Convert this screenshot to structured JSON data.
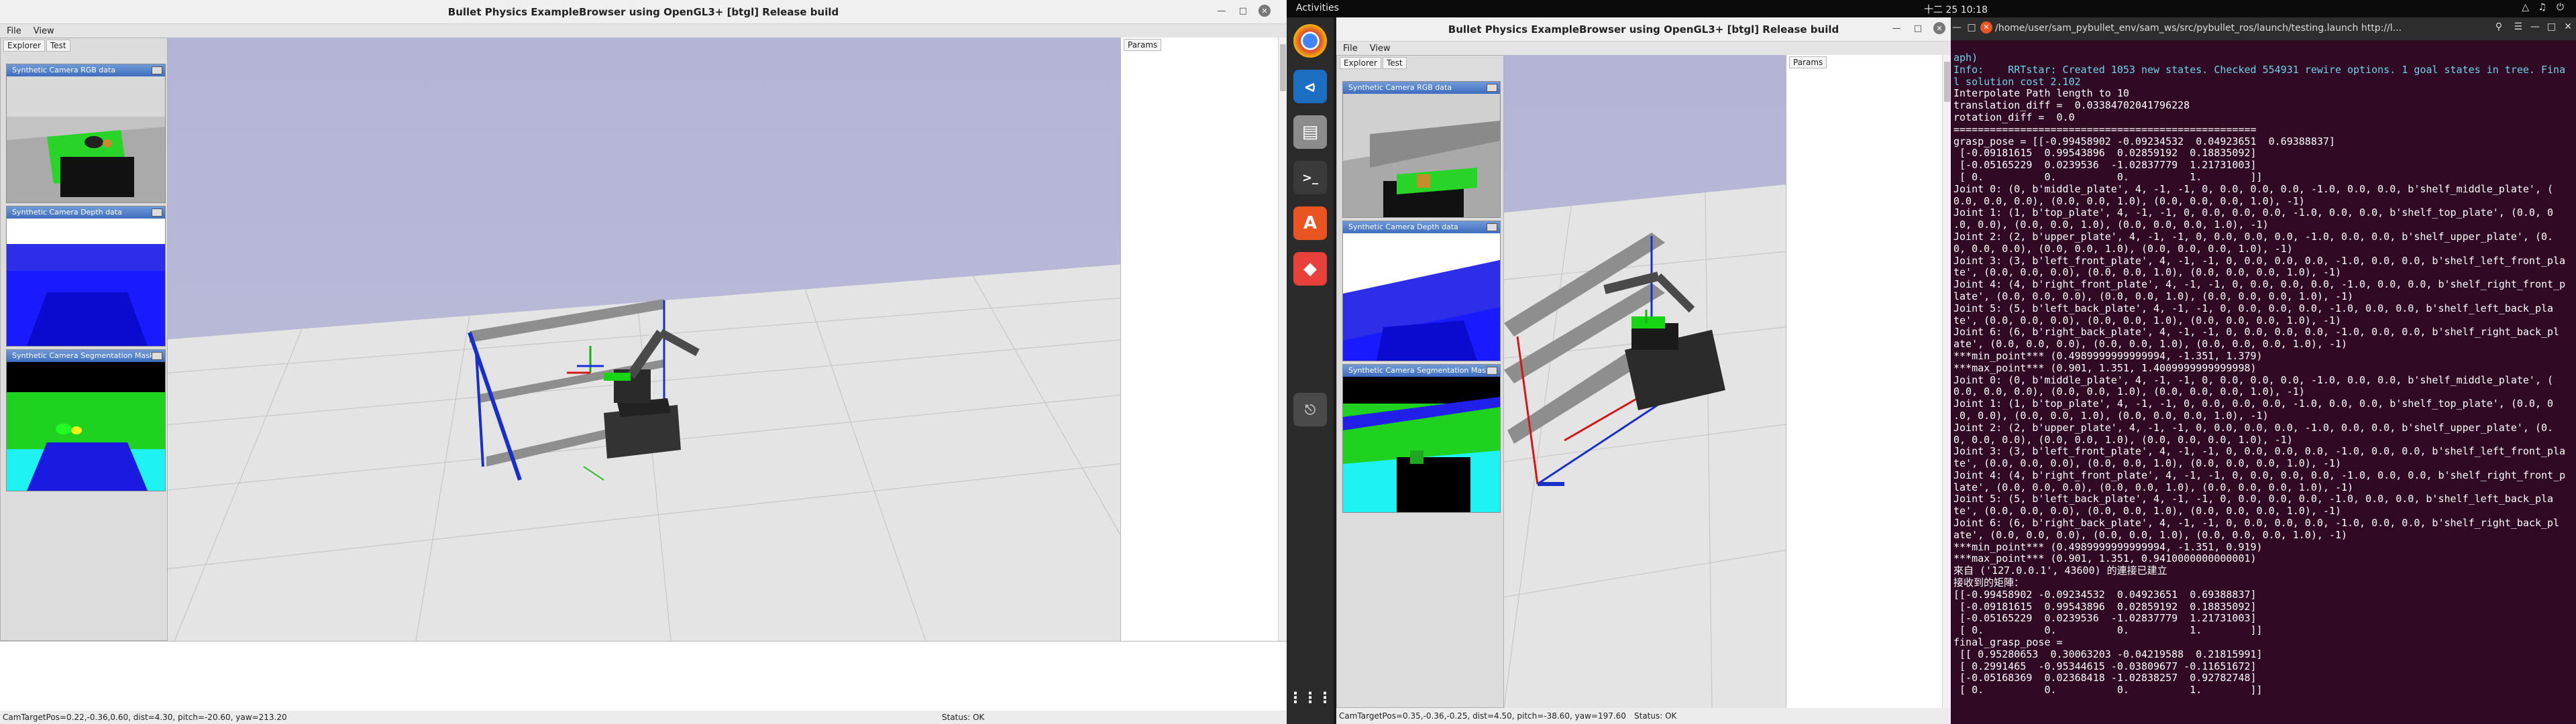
{
  "left_window": {
    "title": "Bullet Physics ExampleBrowser using OpenGL3+ [btgl] Release build",
    "menu": [
      "File",
      "View"
    ],
    "sidebar_tabs": [
      "Explorer",
      "Test"
    ],
    "cam_panels": [
      {
        "title": "Synthetic Camera RGB data"
      },
      {
        "title": "Synthetic Camera Depth data"
      },
      {
        "title": "Synthetic Camera Segmentation Mask"
      }
    ],
    "params_tab": "Params",
    "status_left": "CamTargetPos=0.22,-0.36,0.60, dist=4.30, pitch=-20.60, yaw=213.20",
    "status_right": "Status: OK"
  },
  "right_window": {
    "title": "Bullet Physics ExampleBrowser using OpenGL3+ [btgl] Release build",
    "menu": [
      "File",
      "View"
    ],
    "sidebar_tabs": [
      "Explorer",
      "Test"
    ],
    "cam_panels": [
      {
        "title": "Synthetic Camera RGB data"
      },
      {
        "title": "Synthetic Camera Depth data"
      },
      {
        "title": "Synthetic Camera Segmentation Mask"
      }
    ],
    "params_tab": "Params",
    "status_left": "CamTargetPos=0.35,-0.36,-0.25, dist=4.50, pitch=-38.60, yaw=197.60",
    "status_right": "Status: OK"
  },
  "topbar": {
    "activities": "Activities",
    "clock": "十二 25  10:18"
  },
  "dock": {
    "icons": [
      "chrome-icon",
      "vscode-icon",
      "files-icon",
      "terminal-icon",
      "software-icon",
      "git-icon",
      "usb-icon",
      "apps-grid-icon"
    ]
  },
  "terminal": {
    "title": "/home/user/sam_pybullet_env/sam_ws/src/pybullet_ros/launch/testing.launch http://l...",
    "lines": [
      {
        "t": "aph)",
        "c": "info"
      },
      {
        "t": "Info:    RRTstar: Created 1053 new states. Checked 554931 rewire options. 1 goal states in tree. Fina",
        "c": "info"
      },
      {
        "t": "l solution cost 2.102",
        "c": "info"
      },
      {
        "t": "Interpolate Path length to 10",
        "c": ""
      },
      {
        "t": "translation_diff =  0.03384702041796228",
        "c": ""
      },
      {
        "t": "rotation_diff =  0.0",
        "c": ""
      },
      {
        "t": "==================================================",
        "c": ""
      },
      {
        "t": "grasp_pose = [[-0.99458902 -0.09234532  0.04923651  0.69388837]",
        "c": ""
      },
      {
        "t": " [-0.09181615  0.99543896  0.02859192  0.18835092]",
        "c": ""
      },
      {
        "t": " [-0.05165229  0.0239536  -1.02837779  1.21731003]",
        "c": ""
      },
      {
        "t": " [ 0.          0.          0.          1.        ]]",
        "c": ""
      },
      {
        "t": "Joint 0: (0, b'middle_plate', 4, -1, -1, 0, 0.0, 0.0, 0.0, -1.0, 0.0, 0.0, b'shelf_middle_plate', (",
        "c": ""
      },
      {
        "t": "0.0, 0.0, 0.0), (0.0, 0.0, 1.0), (0.0, 0.0, 0.0, 1.0), -1)",
        "c": ""
      },
      {
        "t": "Joint 1: (1, b'top_plate', 4, -1, -1, 0, 0.0, 0.0, 0.0, -1.0, 0.0, 0.0, b'shelf_top_plate', (0.0, 0",
        "c": ""
      },
      {
        "t": ".0, 0.0), (0.0, 0.0, 1.0), (0.0, 0.0, 0.0, 1.0), -1)",
        "c": ""
      },
      {
        "t": "Joint 2: (2, b'upper_plate', 4, -1, -1, 0, 0.0, 0.0, 0.0, -1.0, 0.0, 0.0, b'shelf_upper_plate', (0.",
        "c": ""
      },
      {
        "t": "0, 0.0, 0.0), (0.0, 0.0, 1.0), (0.0, 0.0, 0.0, 1.0), -1)",
        "c": ""
      },
      {
        "t": "Joint 3: (3, b'left_front_plate', 4, -1, -1, 0, 0.0, 0.0, 0.0, -1.0, 0.0, 0.0, b'shelf_left_front_pla",
        "c": ""
      },
      {
        "t": "te', (0.0, 0.0, 0.0), (0.0, 0.0, 1.0), (0.0, 0.0, 0.0, 1.0), -1)",
        "c": ""
      },
      {
        "t": "Joint 4: (4, b'right_front_plate', 4, -1, -1, 0, 0.0, 0.0, 0.0, -1.0, 0.0, 0.0, b'shelf_right_front_p",
        "c": ""
      },
      {
        "t": "late', (0.0, 0.0, 0.0), (0.0, 0.0, 1.0), (0.0, 0.0, 0.0, 1.0), -1)",
        "c": ""
      },
      {
        "t": "Joint 5: (5, b'left_back_plate', 4, -1, -1, 0, 0.0, 0.0, 0.0, -1.0, 0.0, 0.0, b'shelf_left_back_pla",
        "c": ""
      },
      {
        "t": "te', (0.0, 0.0, 0.0), (0.0, 0.0, 1.0), (0.0, 0.0, 0.0, 1.0), -1)",
        "c": ""
      },
      {
        "t": "Joint 6: (6, b'right_back_plate', 4, -1, -1, 0, 0.0, 0.0, 0.0, -1.0, 0.0, 0.0, b'shelf_right_back_pl",
        "c": ""
      },
      {
        "t": "ate', (0.0, 0.0, 0.0), (0.0, 0.0, 1.0), (0.0, 0.0, 0.0, 1.0), -1)",
        "c": ""
      },
      {
        "t": "***min_point*** (0.4989999999999994, -1.351, 1.379)",
        "c": ""
      },
      {
        "t": "***max_point*** (0.901, 1.351, 1.4009999999999998)",
        "c": ""
      },
      {
        "t": "Joint 0: (0, b'middle_plate', 4, -1, -1, 0, 0.0, 0.0, 0.0, -1.0, 0.0, 0.0, b'shelf_middle_plate', (",
        "c": ""
      },
      {
        "t": "0.0, 0.0, 0.0), (0.0, 0.0, 1.0), (0.0, 0.0, 0.0, 1.0), -1)",
        "c": ""
      },
      {
        "t": "Joint 1: (1, b'top_plate', 4, -1, -1, 0, 0.0, 0.0, 0.0, -1.0, 0.0, 0.0, b'shelf_top_plate', (0.0, 0",
        "c": ""
      },
      {
        "t": ".0, 0.0), (0.0, 0.0, 1.0), (0.0, 0.0, 0.0, 1.0), -1)",
        "c": ""
      },
      {
        "t": "Joint 2: (2, b'upper_plate', 4, -1, -1, 0, 0.0, 0.0, 0.0, -1.0, 0.0, 0.0, b'shelf_upper_plate', (0.",
        "c": ""
      },
      {
        "t": "0, 0.0, 0.0), (0.0, 0.0, 1.0), (0.0, 0.0, 0.0, 1.0), -1)",
        "c": ""
      },
      {
        "t": "Joint 3: (3, b'left_front_plate', 4, -1, -1, 0, 0.0, 0.0, 0.0, -1.0, 0.0, 0.0, b'shelf_left_front_pla",
        "c": ""
      },
      {
        "t": "te', (0.0, 0.0, 0.0), (0.0, 0.0, 1.0), (0.0, 0.0, 0.0, 1.0), -1)",
        "c": ""
      },
      {
        "t": "Joint 4: (4, b'right_front_plate', 4, -1, -1, 0, 0.0, 0.0, 0.0, -1.0, 0.0, 0.0, b'shelf_right_front_p",
        "c": ""
      },
      {
        "t": "late', (0.0, 0.0, 0.0), (0.0, 0.0, 1.0), (0.0, 0.0, 0.0, 1.0), -1)",
        "c": ""
      },
      {
        "t": "Joint 5: (5, b'left_back_plate', 4, -1, -1, 0, 0.0, 0.0, 0.0, -1.0, 0.0, 0.0, b'shelf_left_back_pla",
        "c": ""
      },
      {
        "t": "te', (0.0, 0.0, 0.0), (0.0, 0.0, 1.0), (0.0, 0.0, 0.0, 1.0), -1)",
        "c": ""
      },
      {
        "t": "Joint 6: (6, b'right_back_plate', 4, -1, -1, 0, 0.0, 0.0, 0.0, -1.0, 0.0, 0.0, b'shelf_right_back_pl",
        "c": ""
      },
      {
        "t": "ate', (0.0, 0.0, 0.0), (0.0, 0.0, 1.0), (0.0, 0.0, 0.0, 1.0), -1)",
        "c": ""
      },
      {
        "t": "***min_point*** (0.4989999999999994, -1.351, 0.919)",
        "c": ""
      },
      {
        "t": "***max_point*** (0.901, 1.351, 0.9410000000000001)",
        "c": ""
      },
      {
        "t": "來自 ('127.0.0.1', 43600) 的連接已建立",
        "c": ""
      },
      {
        "t": "接收到的矩陣：",
        "c": ""
      },
      {
        "t": "[[-0.99458902 -0.09234532  0.04923651  0.69388837]",
        "c": ""
      },
      {
        "t": " [-0.09181615  0.99543896  0.02859192  0.18835092]",
        "c": ""
      },
      {
        "t": " [-0.05165229  0.0239536  -1.02837779  1.21731003]",
        "c": ""
      },
      {
        "t": " [ 0.          0.          0.          1.        ]]",
        "c": ""
      },
      {
        "t": "final_grasp_pose =",
        "c": ""
      },
      {
        "t": " [[ 0.95280653  0.30063203 -0.04219588  0.21815991]",
        "c": ""
      },
      {
        "t": " [ 0.2991465  -0.95344615 -0.03809677 -0.11651672]",
        "c": ""
      },
      {
        "t": " [-0.05168369  0.02368418 -1.02838257  0.92782748]",
        "c": ""
      },
      {
        "t": " [ 0.          0.          0.          1.        ]]",
        "c": ""
      }
    ]
  }
}
